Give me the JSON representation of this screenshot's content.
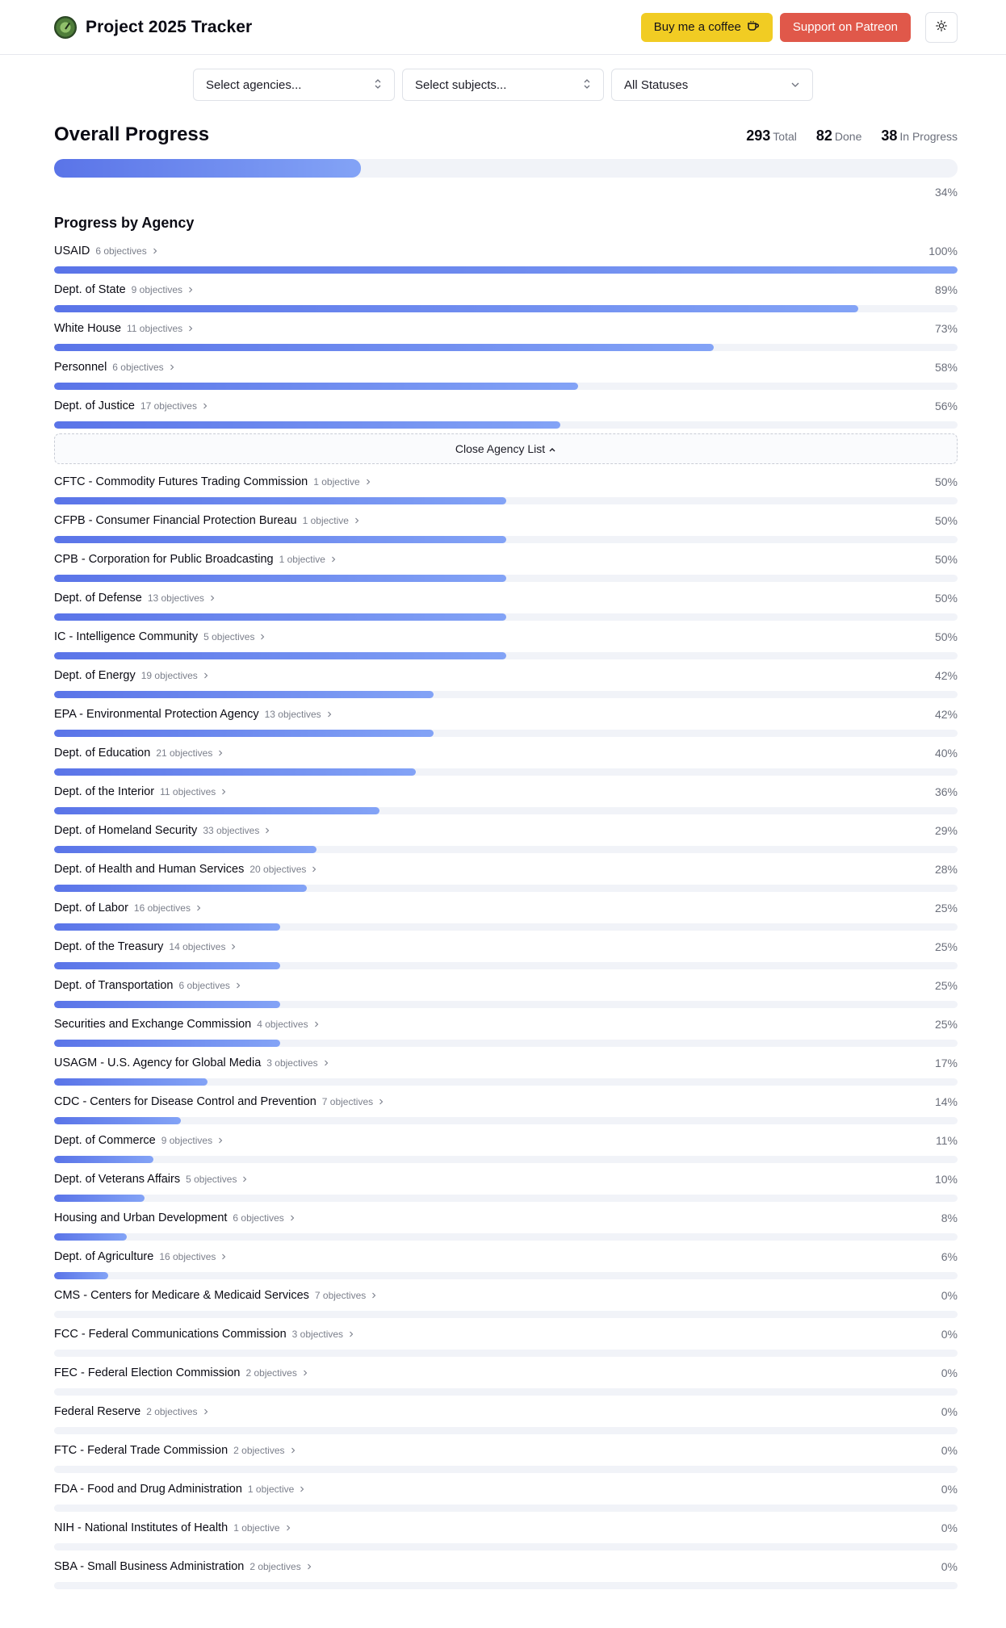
{
  "app": {
    "title": "Project 2025 Tracker",
    "coffee_label": "Buy me a coffee",
    "patreon_label": "Support on Patreon",
    "theme_icon": "sun-icon"
  },
  "filters": {
    "agencies": "Select agencies...",
    "subjects": "Select subjects...",
    "statuses": "All Statuses"
  },
  "overall": {
    "title": "Overall Progress",
    "total_value": "293",
    "total_label": "Total",
    "done_value": "82",
    "done_label": "Done",
    "inprogress_value": "38",
    "inprogress_label": "In Progress",
    "percent": 34,
    "percent_text": "34%"
  },
  "agencies_section": {
    "title": "Progress by Agency",
    "close_label": "Close Agency List"
  },
  "colors": {
    "bar_start": "#5a74e8",
    "bar_end": "#83a3f6",
    "track": "#f1f3f8",
    "coffee": "#f1cc23",
    "patreon": "#e0584a"
  },
  "agencies": [
    {
      "name": "USAID",
      "count": "6 objectives",
      "pct": 100,
      "pct_text": "100%"
    },
    {
      "name": "Dept. of State",
      "count": "9 objectives",
      "pct": 89,
      "pct_text": "89%"
    },
    {
      "name": "White House",
      "count": "11 objectives",
      "pct": 73,
      "pct_text": "73%"
    },
    {
      "name": "Personnel",
      "count": "6 objectives",
      "pct": 58,
      "pct_text": "58%"
    },
    {
      "name": "Dept. of Justice",
      "count": "17 objectives",
      "pct": 56,
      "pct_text": "56%"
    },
    {
      "name": "CFTC - Commodity Futures Trading Commission",
      "count": "1 objective",
      "pct": 50,
      "pct_text": "50%"
    },
    {
      "name": "CFPB - Consumer Financial Protection Bureau",
      "count": "1 objective",
      "pct": 50,
      "pct_text": "50%"
    },
    {
      "name": "CPB - Corporation for Public Broadcasting",
      "count": "1 objective",
      "pct": 50,
      "pct_text": "50%"
    },
    {
      "name": "Dept. of Defense",
      "count": "13 objectives",
      "pct": 50,
      "pct_text": "50%"
    },
    {
      "name": "IC - Intelligence Community",
      "count": "5 objectives",
      "pct": 50,
      "pct_text": "50%"
    },
    {
      "name": "Dept. of Energy",
      "count": "19 objectives",
      "pct": 42,
      "pct_text": "42%"
    },
    {
      "name": "EPA - Environmental Protection Agency",
      "count": "13 objectives",
      "pct": 42,
      "pct_text": "42%"
    },
    {
      "name": "Dept. of Education",
      "count": "21 objectives",
      "pct": 40,
      "pct_text": "40%"
    },
    {
      "name": "Dept. of the Interior",
      "count": "11 objectives",
      "pct": 36,
      "pct_text": "36%"
    },
    {
      "name": "Dept. of Homeland Security",
      "count": "33 objectives",
      "pct": 29,
      "pct_text": "29%"
    },
    {
      "name": "Dept. of Health and Human Services",
      "count": "20 objectives",
      "pct": 28,
      "pct_text": "28%"
    },
    {
      "name": "Dept. of Labor",
      "count": "16 objectives",
      "pct": 25,
      "pct_text": "25%"
    },
    {
      "name": "Dept. of the Treasury",
      "count": "14 objectives",
      "pct": 25,
      "pct_text": "25%"
    },
    {
      "name": "Dept. of Transportation",
      "count": "6 objectives",
      "pct": 25,
      "pct_text": "25%"
    },
    {
      "name": "Securities and Exchange Commission",
      "count": "4 objectives",
      "pct": 25,
      "pct_text": "25%"
    },
    {
      "name": "USAGM - U.S. Agency for Global Media",
      "count": "3 objectives",
      "pct": 17,
      "pct_text": "17%"
    },
    {
      "name": "CDC - Centers for Disease Control and Prevention",
      "count": "7 objectives",
      "pct": 14,
      "pct_text": "14%"
    },
    {
      "name": "Dept. of Commerce",
      "count": "9 objectives",
      "pct": 11,
      "pct_text": "11%"
    },
    {
      "name": "Dept. of Veterans Affairs",
      "count": "5 objectives",
      "pct": 10,
      "pct_text": "10%"
    },
    {
      "name": "Housing and Urban Development",
      "count": "6 objectives",
      "pct": 8,
      "pct_text": "8%"
    },
    {
      "name": "Dept. of Agriculture",
      "count": "16 objectives",
      "pct": 6,
      "pct_text": "6%"
    },
    {
      "name": "CMS - Centers for Medicare & Medicaid Services",
      "count": "7 objectives",
      "pct": 0,
      "pct_text": "0%"
    },
    {
      "name": "FCC - Federal Communications Commission",
      "count": "3 objectives",
      "pct": 0,
      "pct_text": "0%"
    },
    {
      "name": "FEC - Federal Election Commission",
      "count": "2 objectives",
      "pct": 0,
      "pct_text": "0%"
    },
    {
      "name": "Federal Reserve",
      "count": "2 objectives",
      "pct": 0,
      "pct_text": "0%"
    },
    {
      "name": "FTC - Federal Trade Commission",
      "count": "2 objectives",
      "pct": 0,
      "pct_text": "0%"
    },
    {
      "name": "FDA - Food and Drug Administration",
      "count": "1 objective",
      "pct": 0,
      "pct_text": "0%"
    },
    {
      "name": "NIH - National Institutes of Health",
      "count": "1 objective",
      "pct": 0,
      "pct_text": "0%"
    },
    {
      "name": "SBA - Small Business Administration",
      "count": "2 objectives",
      "pct": 0,
      "pct_text": "0%"
    }
  ]
}
